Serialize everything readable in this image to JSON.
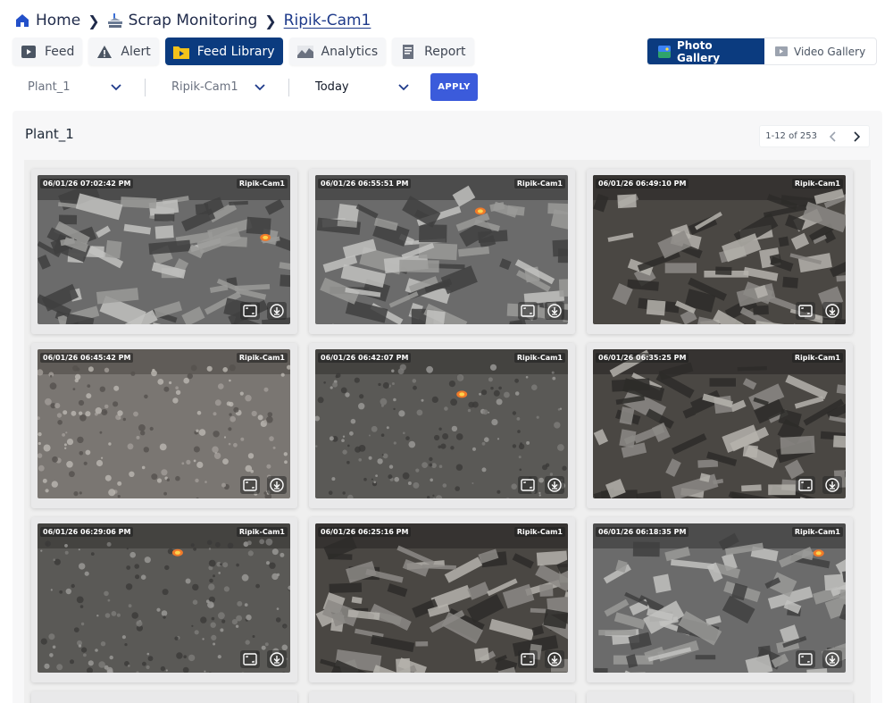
{
  "breadcrumb": {
    "home": "Home",
    "section": "Scrap Monitoring",
    "current": "Ripik-Cam1"
  },
  "tabs": [
    {
      "label": "Feed",
      "icon": "video-feed-icon"
    },
    {
      "label": "Alert",
      "icon": "warning-icon"
    },
    {
      "label": "Feed Library",
      "icon": "folder-play-icon",
      "active": true
    },
    {
      "label": "Analytics",
      "icon": "chart-icon"
    },
    {
      "label": "Report",
      "icon": "document-icon"
    }
  ],
  "gallery": {
    "photo_label": "Photo Gallery",
    "video_label": "Video Gallery",
    "active": "photo"
  },
  "filters": {
    "plant": "Plant_1",
    "camera": "Ripik-Cam1",
    "range": "Today",
    "apply_label": "APPLY"
  },
  "panel": {
    "title": "Plant_1",
    "pagination": "1-12 of 253"
  },
  "colors": {
    "primary": "#0b3b7f",
    "apply": "#3b5bdb",
    "breadcrumb": "#1f2a4a"
  },
  "images": [
    {
      "timestamp": "06/01/26 07:02:42 PM",
      "camera": "Ripik-Cam1",
      "scene": "scrap-pile-mixed",
      "fire": true
    },
    {
      "timestamp": "06/01/26 06:55:51 PM",
      "camera": "Ripik-Cam1",
      "scene": "scrap-pile-mixed",
      "fire": true
    },
    {
      "timestamp": "06/01/26 06:49:10 PM",
      "camera": "Ripik-Cam1",
      "scene": "scrap-sheets-dark",
      "fire": false
    },
    {
      "timestamp": "06/01/26 06:45:42 PM",
      "camera": "Ripik-Cam1",
      "scene": "scrap-granular-light",
      "fire": false
    },
    {
      "timestamp": "06/01/26 06:42:07 PM",
      "camera": "Ripik-Cam1",
      "scene": "scrap-granular-dark",
      "fire": true
    },
    {
      "timestamp": "06/01/26 06:35:25 PM",
      "camera": "Ripik-Cam1",
      "scene": "scrap-sheets-dark",
      "fire": false
    },
    {
      "timestamp": "06/01/26 06:29:06 PM",
      "camera": "Ripik-Cam1",
      "scene": "scrap-granular-dark",
      "fire": true
    },
    {
      "timestamp": "06/01/26 06:25:16 PM",
      "camera": "Ripik-Cam1",
      "scene": "scrap-sheets-dark",
      "fire": false
    },
    {
      "timestamp": "06/01/26 06:18:35 PM",
      "camera": "Ripik-Cam1",
      "scene": "scrap-pile-mixed",
      "fire": true
    }
  ]
}
